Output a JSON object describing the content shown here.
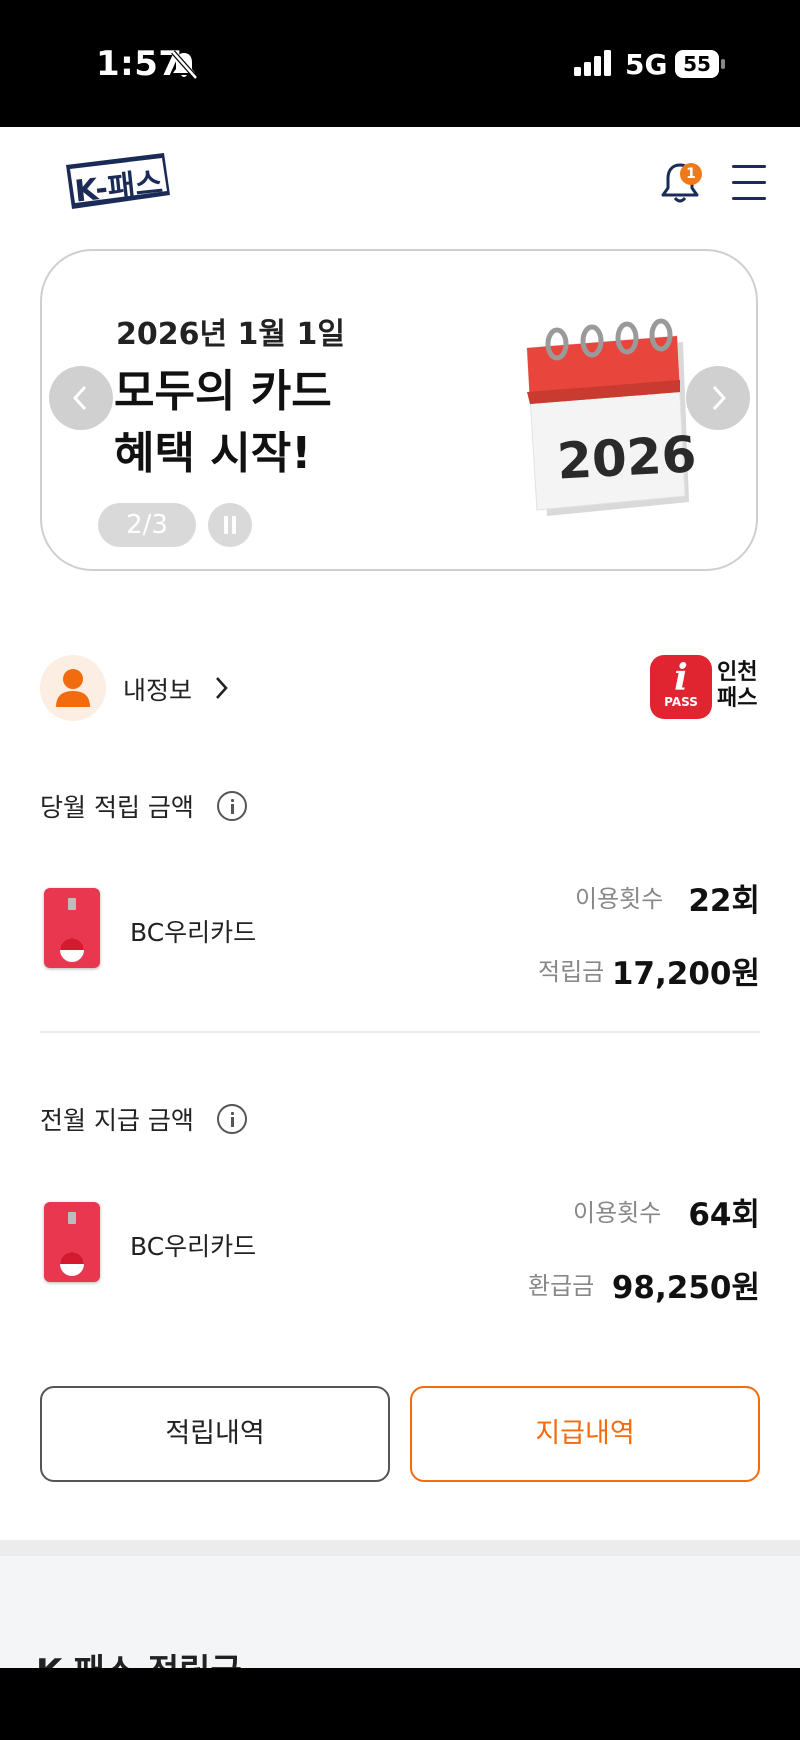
{
  "status_bar": {
    "time": "1:57",
    "network": "5G",
    "battery": "55"
  },
  "header": {
    "logo_text": "K-패스",
    "notification_count": "1"
  },
  "banner": {
    "date_text": "2026년 1월 1일",
    "title_line1": "모두의 카드",
    "title_line2": "혜택 시작!",
    "pager": "2/3",
    "calendar_year": "2026"
  },
  "profile": {
    "label": "내정보",
    "partner_logo_line1": "인천",
    "partner_logo_line2": "패스",
    "partner_logo_sub": "PASS"
  },
  "current_month": {
    "title": "당월 적립 금액",
    "card_name": "BC우리카드",
    "usage_label": "이용횟수",
    "usage_value": "22회",
    "amount_label": "적립금",
    "amount_value": "17,200원"
  },
  "previous_month": {
    "title": "전월 지급 금액",
    "card_name": "BC우리카드",
    "usage_label": "이용횟수",
    "usage_value": "64회",
    "amount_label": "환급금",
    "amount_value": "98,250원"
  },
  "buttons": {
    "accrual_history": "적립내역",
    "payment_history": "지급내역"
  },
  "footer": {
    "heading": "K-패스 적립금"
  },
  "colors": {
    "accent": "#f26b0f",
    "brand_navy": "#1a2b57",
    "card_red": "#e8374f"
  }
}
